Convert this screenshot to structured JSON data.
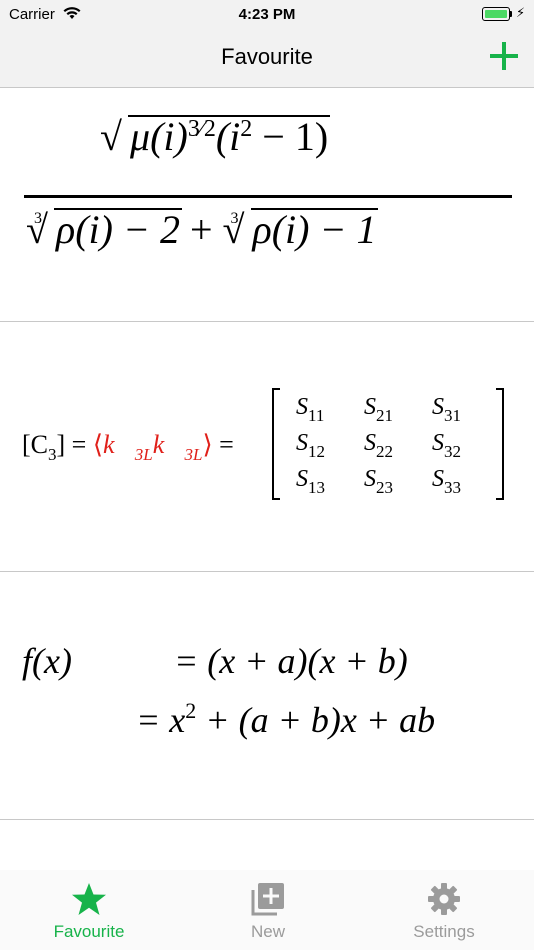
{
  "status_bar": {
    "carrier": "Carrier",
    "time": "4:23 PM",
    "wifi_icon": "wifi-icon",
    "battery_icon": "battery-icon"
  },
  "nav_bar": {
    "title": "Favourite",
    "add_icon": "plus-icon"
  },
  "colors": {
    "accent": "#17b34a",
    "tab_inactive": "#9b9b9b",
    "highlight": "#e0201a"
  },
  "formulas": [
    {
      "numerator": {
        "mu": "μ(i)",
        "exp_num": "3",
        "exp_den": "2",
        "paren_open": "(i",
        "sq": "2",
        "rest": " − 1)"
      },
      "denominator": {
        "root1_index": "3",
        "root1_body": "ρ(i) − 2",
        "plus": " + ",
        "root2_index": "3",
        "root2_body": "ρ(i) − 1"
      }
    },
    {
      "lhs": "[C",
      "lhs_sub": "3",
      "lhs_close": "] = ",
      "bracket_open": "⟨",
      "k1": "k⃗",
      "k1_sub": "3L",
      "k2": "k⃗",
      "k2_sub": "3L",
      "bracket_close": "⟩",
      "equals": " =",
      "matrix": [
        [
          "S",
          "11"
        ],
        [
          "S",
          "21"
        ],
        [
          "S",
          "31"
        ],
        [
          "S",
          "12"
        ],
        [
          "S",
          "22"
        ],
        [
          "S",
          "32"
        ],
        [
          "S",
          "13"
        ],
        [
          "S",
          "23"
        ],
        [
          "S",
          "33"
        ]
      ]
    },
    {
      "lhs": "f(x)",
      "line1": "= (x + a)(x + b)",
      "line2_a": "= x",
      "line2_sup": "2",
      "line2_b": " + (a + b)x + ab"
    }
  ],
  "tabs": [
    {
      "label": "Favourite",
      "icon": "star-icon",
      "active": true
    },
    {
      "label": "New",
      "icon": "add-square-icon",
      "active": false
    },
    {
      "label": "Settings",
      "icon": "gear-icon",
      "active": false
    }
  ]
}
